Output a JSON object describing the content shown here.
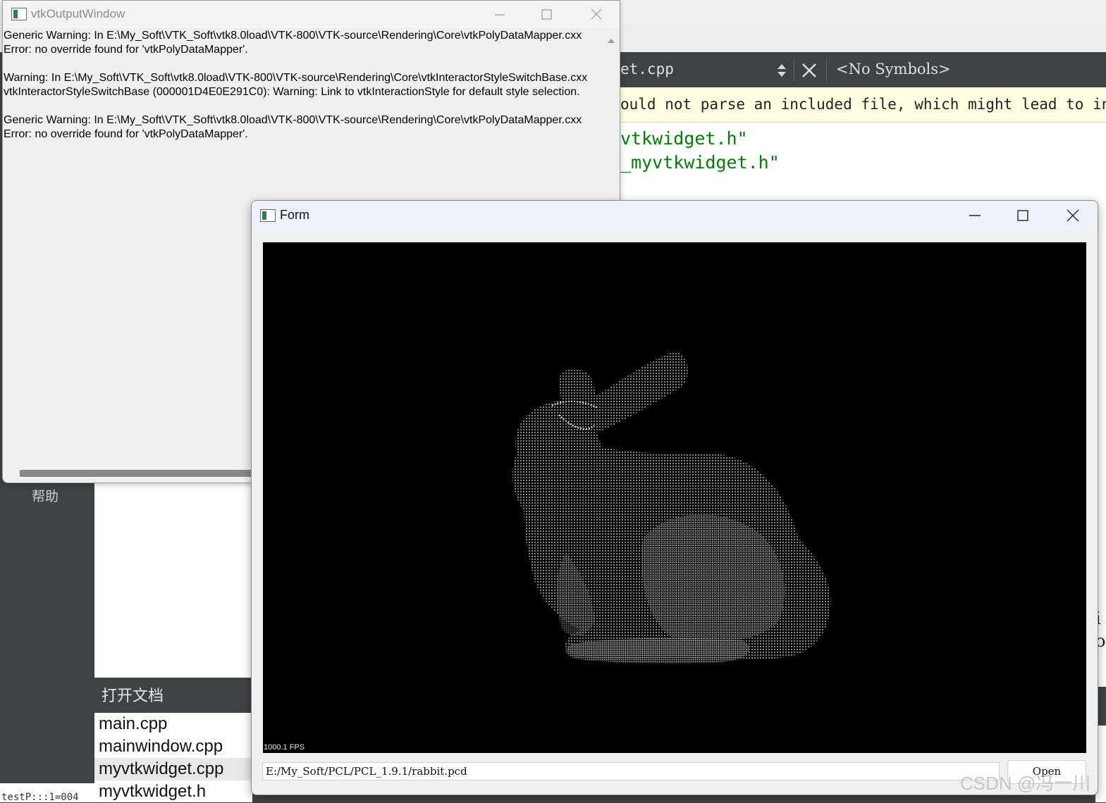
{
  "vtk_output_window": {
    "title": "vtkOutputWindow",
    "messages": [
      "Generic Warning: In E:\\My_Soft\\VTK_Soft\\vtk8.0load\\VTK-800\\VTK-source\\Rendering\\Core\\vtkPolyDataMapper.cxx",
      "Error: no override found for 'vtkPolyDataMapper'.",
      "",
      "Warning: In E:\\My_Soft\\VTK_Soft\\vtk8.0load\\VTK-800\\VTK-source\\Rendering\\Core\\vtkInteractorStyleSwitchBase.cxx",
      "vtkInteractorStyleSwitchBase (000001D4E0E291C0): Warning: Link to vtkInteractionStyle for default style selection.",
      "",
      "Generic Warning: In E:\\My_Soft\\VTK_Soft\\vtk8.0load\\VTK-800\\VTK-source\\Rendering\\Core\\vtkPolyDataMapper.cxx",
      "Error: no override found for 'vtkPolyDataMapper'."
    ]
  },
  "form_window": {
    "title": "Form",
    "fps": "1000.1 FPS",
    "path_value": "E:/My_Soft/PCL/PCL_1.9.1/rabbit.pcd",
    "open_label": "Open"
  },
  "editor": {
    "current_file": "et.cpp",
    "symbols": "<No Symbols>",
    "warning": "ould not parse an included file, which might lead to incorrect code completion",
    "code_lines": [
      "vtkwidget.h\"",
      "_myvtkwidget.h\""
    ],
    "right_fragment": [
      "i",
      "o"
    ]
  },
  "sidebar": {
    "help_label": "帮助"
  },
  "open_documents": {
    "header": "打开文档",
    "items": [
      "main.cpp",
      "mainwindow.cpp",
      "myvtkwidget.cpp",
      "myvtkwidget.h"
    ],
    "selected_index": 2
  },
  "status": {
    "project_fragment": "testP:::1=004"
  },
  "watermark": "CSDN @冯一川"
}
